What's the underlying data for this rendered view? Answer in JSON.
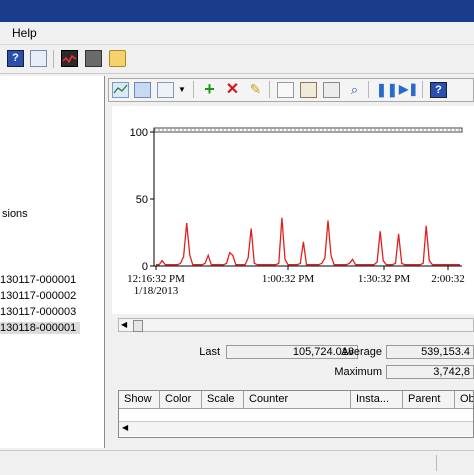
{
  "menu": {
    "help": "Help"
  },
  "tree": {
    "fragment": "sions",
    "logs": [
      "130117-000001",
      "130117-000002",
      "130117-000003",
      "130118-000001"
    ]
  },
  "toolbar_icons": {
    "top": [
      "help-icon",
      "properties-icon",
      "monitor-icon",
      "report-icon",
      "folder-icon"
    ],
    "chart": [
      "view-graph-icon",
      "view-log-icon",
      "change-graph-type-icon",
      "dropdown-arrow-icon",
      "add-counter-icon",
      "delete-counter-icon",
      "highlight-icon",
      "copy-properties-icon",
      "paste-counter-list-icon",
      "properties-icon",
      "zoom-icon",
      "freeze-display-icon",
      "update-data-icon",
      "help-icon"
    ]
  },
  "chart_data": {
    "type": "line",
    "y_ticks": [
      "100",
      "50",
      "0"
    ],
    "ylim": [
      0,
      100
    ],
    "x_tick_labels": [
      {
        "line1": "12:16:32 PM",
        "line2": "1/18/2013"
      },
      {
        "line1": "1:00:32 PM",
        "line2": ""
      },
      {
        "line1": "1:30:32 PM",
        "line2": ""
      },
      {
        "line1": "2:00:32",
        "line2": ""
      }
    ],
    "series": [
      {
        "color": "#e21f1f",
        "values": [
          1,
          1,
          4,
          1,
          1,
          1,
          1,
          1,
          2,
          7,
          32,
          8,
          1,
          1,
          1,
          1,
          2,
          8,
          1,
          1,
          1,
          1,
          1,
          2,
          10,
          8,
          1,
          1,
          1,
          1,
          6,
          28,
          2,
          1,
          1,
          1,
          1,
          1,
          1,
          1,
          2,
          36,
          5,
          1,
          1,
          1,
          1,
          2,
          18,
          1,
          1,
          1,
          1,
          1,
          2,
          6,
          34,
          8,
          1,
          1,
          1,
          1,
          1,
          2,
          5,
          1,
          1,
          1,
          1,
          1,
          1,
          1,
          3,
          26,
          4,
          1,
          1,
          1,
          2,
          24,
          2,
          1,
          1,
          1,
          1,
          1,
          1,
          2,
          30,
          4,
          1,
          1,
          1,
          1,
          1,
          1,
          1,
          1,
          1,
          1
        ]
      }
    ]
  },
  "stats": {
    "last_label": "Last",
    "last_value": "105,724.018",
    "average_label": "Average",
    "average_value": "539,153.4",
    "maximum_label": "Maximum",
    "maximum_value": "3,742,8"
  },
  "grid": {
    "columns": [
      "Show",
      "Color",
      "Scale",
      "Counter",
      "Insta...",
      "Parent",
      "Ob"
    ]
  }
}
